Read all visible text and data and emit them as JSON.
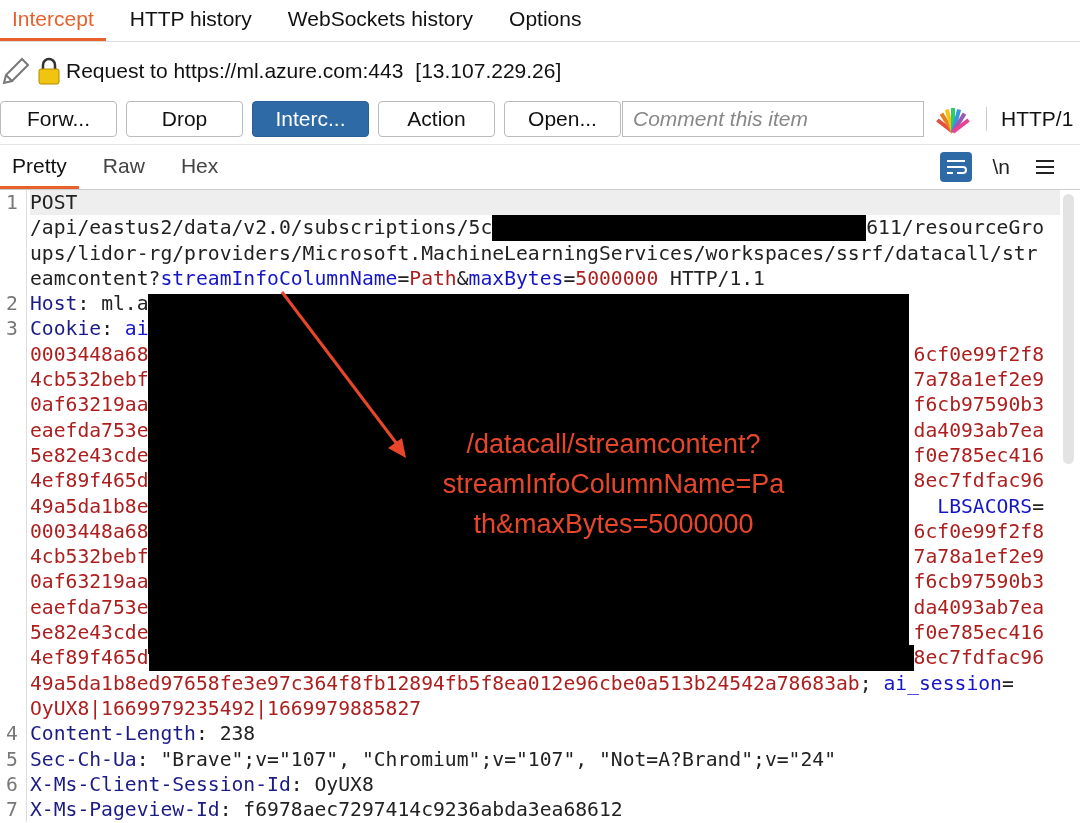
{
  "tabs": [
    {
      "label": "Intercept",
      "selected": true
    },
    {
      "label": "HTTP history",
      "selected": false
    },
    {
      "label": "WebSockets history",
      "selected": false
    },
    {
      "label": "Options",
      "selected": false
    }
  ],
  "request": {
    "label": "Request to https://ml.azure.com:443",
    "ip": "[13.107.229.26]"
  },
  "buttons": [
    {
      "label": "Forw...",
      "on": false
    },
    {
      "label": "Drop",
      "on": false
    },
    {
      "label": "Interc...",
      "on": true
    },
    {
      "label": "Action",
      "on": false
    },
    {
      "label": "Open...",
      "on": false
    }
  ],
  "comment": {
    "placeholder": "Comment this item"
  },
  "protocol": "HTTP/1",
  "view_tabs": [
    {
      "label": "Pretty",
      "selected": true
    },
    {
      "label": "Raw",
      "selected": false
    },
    {
      "label": "Hex",
      "selected": false
    }
  ],
  "newline_toggle": "\\n",
  "lines": [
    {
      "number": "1",
      "rows": [
        {
          "left": [
            {
              "kind": "plain",
              "text": "POST"
            }
          ]
        },
        {
          "left": [
            {
              "kind": "plain",
              "text": "/api/eastus2/data/v2.0/subscriptions/5c"
            }
          ],
          "redacted": true,
          "right": [
            {
              "kind": "plain",
              "text": "611/resourceGro"
            }
          ]
        },
        {
          "left": [
            {
              "kind": "plain",
              "text": "ups/lidor-rg/providers/Microsoft.MachineLearningServices/workspaces/ssrf/datacall/str"
            }
          ]
        },
        {
          "left": [
            {
              "kind": "plain",
              "text": "eamcontent?"
            },
            {
              "kind": "name",
              "text": "streamInfoColumnName"
            },
            {
              "kind": "plain",
              "text": "="
            },
            {
              "kind": "value",
              "text": "Path"
            },
            {
              "kind": "plain",
              "text": "&"
            },
            {
              "kind": "name",
              "text": "maxBytes"
            },
            {
              "kind": "plain",
              "text": "="
            },
            {
              "kind": "value",
              "text": "5000000"
            },
            {
              "kind": "plain",
              "text": " HTTP/1.1"
            }
          ]
        }
      ]
    },
    {
      "number": "2",
      "rows": [
        {
          "left": [
            {
              "kind": "header",
              "text": "Host"
            },
            {
              "kind": "plain",
              "text": ": ml.a"
            }
          ]
        }
      ]
    },
    {
      "number": "3",
      "rows": [
        {
          "left": [
            {
              "kind": "header",
              "text": "Cookie"
            },
            {
              "kind": "plain",
              "text": ": "
            },
            {
              "kind": "name",
              "text": "ai"
            }
          ]
        },
        {
          "left": [
            {
              "kind": "value",
              "text": "0003448a68"
            }
          ],
          "right": [
            {
              "kind": "value",
              "text": "6cf0e99f2f8"
            }
          ]
        },
        {
          "left": [
            {
              "kind": "value",
              "text": "4cb532bebf"
            }
          ],
          "right": [
            {
              "kind": "value",
              "text": "7a78a1ef2e9"
            }
          ]
        },
        {
          "left": [
            {
              "kind": "value",
              "text": "0af63219aa"
            }
          ],
          "right": [
            {
              "kind": "value",
              "text": "f6cb97590b3"
            }
          ]
        },
        {
          "left": [
            {
              "kind": "value",
              "text": "eaefda753e"
            }
          ],
          "right": [
            {
              "kind": "value",
              "text": "da4093ab7ea"
            }
          ]
        },
        {
          "left": [
            {
              "kind": "value",
              "text": "5e82e43cde"
            }
          ],
          "right": [
            {
              "kind": "value",
              "text": "f0e785ec416"
            }
          ]
        },
        {
          "left": [
            {
              "kind": "value",
              "text": "4ef89f465d"
            }
          ],
          "right": [
            {
              "kind": "value",
              "text": "8ec7fdfac96"
            }
          ]
        },
        {
          "left": [
            {
              "kind": "value",
              "text": "49a5da1b8e"
            }
          ],
          "right": [
            {
              "kind": "name",
              "text": "LBSACORS"
            },
            {
              "kind": "plain",
              "text": "="
            }
          ]
        },
        {
          "left": [
            {
              "kind": "value",
              "text": "0003448a68"
            }
          ],
          "right": [
            {
              "kind": "value",
              "text": "6cf0e99f2f8"
            }
          ]
        },
        {
          "left": [
            {
              "kind": "value",
              "text": "4cb532bebf"
            }
          ],
          "right": [
            {
              "kind": "value",
              "text": "7a78a1ef2e9"
            }
          ]
        },
        {
          "left": [
            {
              "kind": "value",
              "text": "0af63219aa"
            }
          ],
          "right": [
            {
              "kind": "value",
              "text": "f6cb97590b3"
            }
          ]
        },
        {
          "left": [
            {
              "kind": "value",
              "text": "eaefda753e"
            }
          ],
          "right": [
            {
              "kind": "value",
              "text": "da4093ab7ea"
            }
          ]
        },
        {
          "left": [
            {
              "kind": "value",
              "text": "5e82e43cde"
            }
          ],
          "right": [
            {
              "kind": "value",
              "text": "f0e785ec416"
            }
          ]
        },
        {
          "left": [
            {
              "kind": "value",
              "text": "4ef89f465d"
            }
          ],
          "redacted": true,
          "right": [
            {
              "kind": "value",
              "text": "8ec7fdfac96"
            }
          ]
        },
        {
          "left": [
            {
              "kind": "value",
              "text": "49a5da1b8ed97658fe3e97c364f8fb12894fb5f8ea012e96cbe0a513b24542a78683ab"
            },
            {
              "kind": "plain",
              "text": "; "
            },
            {
              "kind": "name",
              "text": "ai_session"
            },
            {
              "kind": "plain",
              "text": "="
            }
          ]
        },
        {
          "left": [
            {
              "kind": "value",
              "text": "OyUX8|1669979235492|1669979885827"
            }
          ]
        }
      ]
    },
    {
      "number": "4",
      "rows": [
        {
          "left": [
            {
              "kind": "header",
              "text": "Content-Length"
            },
            {
              "kind": "plain",
              "text": ": 238"
            }
          ]
        }
      ]
    },
    {
      "number": "5",
      "rows": [
        {
          "left": [
            {
              "kind": "header",
              "text": "Sec-Ch-Ua"
            },
            {
              "kind": "plain",
              "text": ": \"Brave\";v=\"107\", \"Chromium\";v=\"107\", \"Not=A?Brand\";v=\"24\""
            }
          ]
        }
      ]
    },
    {
      "number": "6",
      "rows": [
        {
          "left": [
            {
              "kind": "header",
              "text": "X-Ms-Client-Session-Id"
            },
            {
              "kind": "plain",
              "text": ": OyUX8"
            }
          ]
        }
      ]
    },
    {
      "number": "7",
      "rows": [
        {
          "left": [
            {
              "kind": "header",
              "text": "X-Ms-Pageview-Id"
            },
            {
              "kind": "plain",
              "text": ": f6978aec7297414c9236abda3ea68612"
            }
          ]
        }
      ]
    }
  ],
  "annotation": {
    "lines": [
      "/datacall/streamcontent?",
      "streamInfoColumnName=Pa",
      "th&maxBytes=5000000"
    ]
  }
}
